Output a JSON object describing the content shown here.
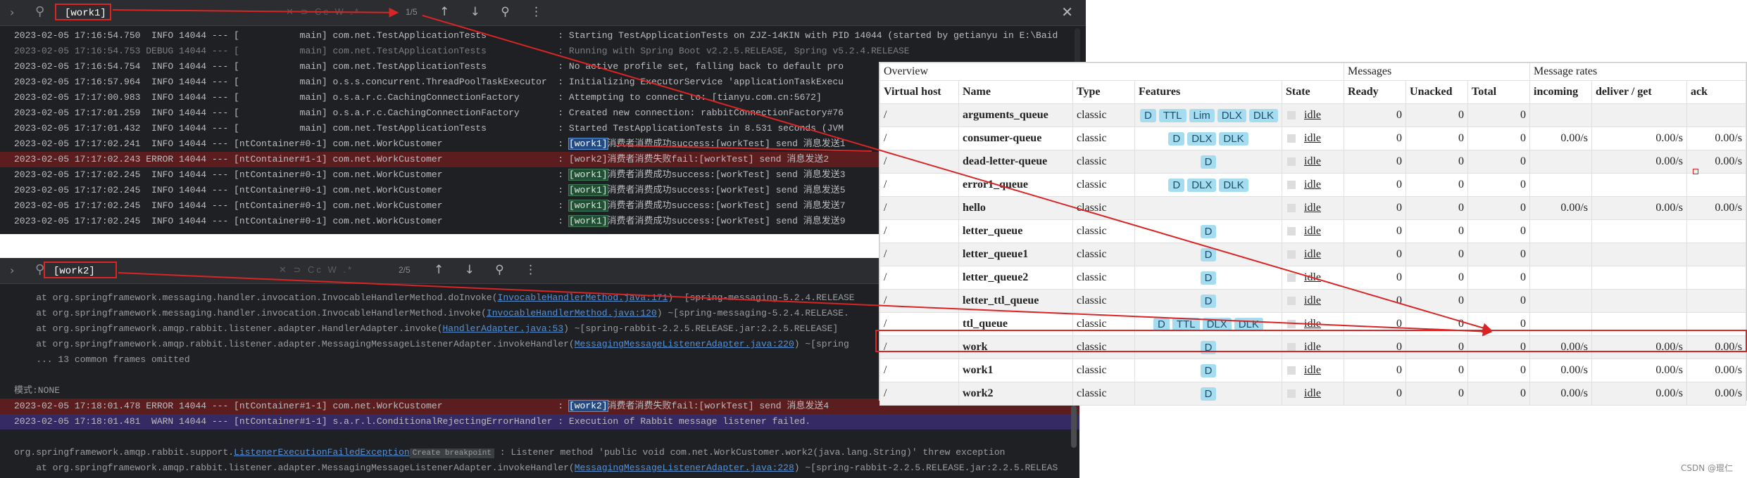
{
  "top_console": {
    "search_text": "[work1]",
    "search_options": "✕ ⊃ Cc W .*",
    "match_count": "1/5",
    "nav_icons": "↑ ↓ ⚲ ⋮",
    "close_glyph": "✕",
    "lines": [
      {
        "text": "2023-02-05 17:16:54.750  INFO 14044 --- [           main] com.net.TestApplicationTests             : Starting TestApplicationTests on ZJZ-14KIN with PID 14044 (started by getianyu in E:\\Baid",
        "kind": "info"
      },
      {
        "text": "2023-02-05 17:16:54.753 DEBUG 14044 --- [           main] com.net.TestApplicationTests             : Running with Spring Boot v2.2.5.RELEASE, Spring v5.2.4.RELEASE",
        "kind": "debug"
      },
      {
        "text": "2023-02-05 17:16:54.754  INFO 14044 --- [           main] com.net.TestApplicationTests             : No active profile set, falling back to default pro",
        "kind": "info"
      },
      {
        "text": "2023-02-05 17:16:57.964  INFO 14044 --- [           main] o.s.s.concurrent.ThreadPoolTaskExecutor  : Initializing ExecutorService 'applicationTaskExecu",
        "kind": "info"
      },
      {
        "text": "2023-02-05 17:17:00.983  INFO 14044 --- [           main] o.s.a.r.c.CachingConnectionFactory       : Attempting to connect to: [tianyu.com.cn:5672]",
        "kind": "info"
      },
      {
        "text": "2023-02-05 17:17:01.259  INFO 14044 --- [           main] o.s.a.r.c.CachingConnectionFactory       : Created new connection: rabbitConnectionFactory#76",
        "kind": "info"
      },
      {
        "text": "2023-02-05 17:17:01.432  INFO 14044 --- [           main] com.net.TestApplicationTests             : Started TestApplicationTests in 8.531 seconds (JVM",
        "kind": "info"
      },
      {
        "prefix": "2023-02-05 17:17:02.241  INFO 14044 --- [ntContainer#0-1] com.net.WorkCustomer                     : ",
        "tag": "[work1]",
        "tag_style": "blue",
        "suffix": "消费者消费成功success:[workTest] send 消息发送1",
        "kind": "info"
      },
      {
        "prefix": "2023-02-05 17:17:02.243 ERROR 14044 --- [ntContainer#1-1] com.net.WorkCustomer                     : ",
        "tag": "[work2]",
        "tag_style": "none",
        "suffix": "消费者消费失败fail:[workTest] send 消息发送2",
        "kind": "error"
      },
      {
        "prefix": "2023-02-05 17:17:02.245  INFO 14044 --- [ntContainer#0-1] com.net.WorkCustomer                     : ",
        "tag": "[work1]",
        "tag_style": "green",
        "suffix": "消费者消费成功success:[workTest] send 消息发送3",
        "kind": "info"
      },
      {
        "prefix": "2023-02-05 17:17:02.245  INFO 14044 --- [ntContainer#0-1] com.net.WorkCustomer                     : ",
        "tag": "[work1]",
        "tag_style": "green",
        "suffix": "消费者消费成功success:[workTest] send 消息发送5",
        "kind": "info"
      },
      {
        "prefix": "2023-02-05 17:17:02.245  INFO 14044 --- [ntContainer#0-1] com.net.WorkCustomer                     : ",
        "tag": "[work1]",
        "tag_style": "green",
        "suffix": "消费者消费成功success:[workTest] send 消息发送7",
        "kind": "info"
      },
      {
        "prefix": "2023-02-05 17:17:02.245  INFO 14044 --- [ntContainer#0-1] com.net.WorkCustomer                     : ",
        "tag": "[work1]",
        "tag_style": "green",
        "suffix": "消费者消费成功success:[workTest] send 消息发送9",
        "kind": "info"
      }
    ]
  },
  "bottom_console": {
    "search_text": "[work2]",
    "search_options": "✕ ⊃ Cc W .*",
    "match_count": "2/5",
    "nav_icons": "↑ ↓ ⚲ ⋮",
    "lines": [
      {
        "prefix": "    at org.springframework.messaging.handler.invocation.InvocableHandlerMethod.doInvoke(",
        "link": "InvocableHandlerMethod.java:171",
        "suffix": ") ~[spring-messaging-5.2.4.RELEASE",
        "kind": "dim"
      },
      {
        "prefix": "    at org.springframework.messaging.handler.invocation.InvocableHandlerMethod.invoke(",
        "link": "InvocableHandlerMethod.java:120",
        "suffix": ") ~[spring-messaging-5.2.4.RELEASE.",
        "kind": "dim"
      },
      {
        "prefix": "    at org.springframework.amqp.rabbit.listener.adapter.HandlerAdapter.invoke(",
        "link": "HandlerAdapter.java:53",
        "suffix": ") ~[spring-rabbit-2.2.5.RELEASE.jar:2.2.5.RELEASE]",
        "kind": "dim"
      },
      {
        "prefix": "    at org.springframework.amqp.rabbit.listener.adapter.MessagingMessageListenerAdapter.invokeHandler(",
        "link": "MessagingMessageListenerAdapter.java:220",
        "suffix": ") ~[spring",
        "kind": "dim"
      },
      {
        "text": "    ... 13 common frames omitted",
        "kind": "dim"
      },
      {
        "text": "",
        "kind": "dim"
      },
      {
        "text": "模式:NONE",
        "kind": "dim"
      },
      {
        "prefix": "2023-02-05 17:18:01.478 ERROR 14044 --- [ntContainer#1-1] com.net.WorkCustomer                     : ",
        "tag": "[work2]",
        "tag_style": "blue",
        "suffix": "消费者消费失败fail:[workTest] send 消息发送4",
        "kind": "error"
      },
      {
        "text": "2023-02-05 17:18:01.481  WARN 14044 --- [ntContainer#1-1] s.a.r.l.ConditionalRejectingErrorHandler : Execution of Rabbit message listener failed.",
        "kind": "warn-hl"
      },
      {
        "text": "",
        "kind": "dim"
      },
      {
        "prefix": "org.springframework.amqp.rabbit.support.",
        "link": "ListenerExecutionFailedException",
        "chip": "Create breakpoint",
        "suffix": " : Listener method 'public void com.net.WorkCustomer.work2(java.lang.String)' threw exception",
        "kind": "dim"
      },
      {
        "prefix": "    at org.springframework.amqp.rabbit.listener.adapter.MessagingMessageListenerAdapter.invokeHandler(",
        "link": "MessagingMessageListenerAdapter.java:228",
        "suffix": ") ~[spring-rabbit-2.2.5.RELEASE.jar:2.2.5.RELEAS",
        "kind": "dim"
      }
    ]
  },
  "queues": {
    "group_headers": [
      "Overview",
      "Messages",
      "Message rates"
    ],
    "columns": [
      "Virtual host",
      "Name",
      "Type",
      "Features",
      "State",
      "Ready",
      "Unacked",
      "Total",
      "incoming",
      "deliver / get",
      "ack"
    ],
    "rows": [
      {
        "vhost": "/",
        "name": "arguments_queue",
        "type": "classic",
        "features": [
          "D",
          "TTL",
          "Lim",
          "DLX",
          "DLK"
        ],
        "state": "idle",
        "ready": "0",
        "unacked": "0",
        "total": "0",
        "incoming": "",
        "deliver": "",
        "ack": ""
      },
      {
        "vhost": "/",
        "name": "consumer-queue",
        "type": "classic",
        "features": [
          "D",
          "DLX",
          "DLK"
        ],
        "state": "idle",
        "ready": "0",
        "unacked": "0",
        "total": "0",
        "incoming": "0.00/s",
        "deliver": "0.00/s",
        "ack": "0.00/s"
      },
      {
        "vhost": "/",
        "name": "dead-letter-queue",
        "type": "classic",
        "features": [
          "D"
        ],
        "state": "idle",
        "ready": "0",
        "unacked": "0",
        "total": "0",
        "incoming": "",
        "deliver": "0.00/s",
        "ack": "0.00/s"
      },
      {
        "vhost": "/",
        "name": "error1_queue",
        "type": "classic",
        "features": [
          "D",
          "DLX",
          "DLK"
        ],
        "state": "idle",
        "ready": "0",
        "unacked": "0",
        "total": "0",
        "incoming": "",
        "deliver": "",
        "ack": ""
      },
      {
        "vhost": "/",
        "name": "hello",
        "type": "classic",
        "features": [],
        "state": "idle",
        "ready": "0",
        "unacked": "0",
        "total": "0",
        "incoming": "0.00/s",
        "deliver": "0.00/s",
        "ack": "0.00/s"
      },
      {
        "vhost": "/",
        "name": "letter_queue",
        "type": "classic",
        "features": [
          "D"
        ],
        "state": "idle",
        "ready": "0",
        "unacked": "0",
        "total": "0",
        "incoming": "",
        "deliver": "",
        "ack": ""
      },
      {
        "vhost": "/",
        "name": "letter_queue1",
        "type": "classic",
        "features": [
          "D"
        ],
        "state": "idle",
        "ready": "0",
        "unacked": "0",
        "total": "0",
        "incoming": "",
        "deliver": "",
        "ack": ""
      },
      {
        "vhost": "/",
        "name": "letter_queue2",
        "type": "classic",
        "features": [
          "D"
        ],
        "state": "idle",
        "ready": "0",
        "unacked": "0",
        "total": "0",
        "incoming": "",
        "deliver": "",
        "ack": ""
      },
      {
        "vhost": "/",
        "name": "letter_ttl_queue",
        "type": "classic",
        "features": [
          "D"
        ],
        "state": "idle",
        "ready": "0",
        "unacked": "0",
        "total": "0",
        "incoming": "",
        "deliver": "",
        "ack": ""
      },
      {
        "vhost": "/",
        "name": "ttl_queue",
        "type": "classic",
        "features": [
          "D",
          "TTL",
          "DLX",
          "DLK"
        ],
        "state": "idle",
        "ready": "0",
        "unacked": "0",
        "total": "0",
        "incoming": "",
        "deliver": "",
        "ack": ""
      },
      {
        "vhost": "/",
        "name": "work",
        "type": "classic",
        "features": [
          "D"
        ],
        "state": "idle",
        "ready": "0",
        "unacked": "0",
        "total": "0",
        "incoming": "0.00/s",
        "deliver": "0.00/s",
        "ack": "0.00/s"
      },
      {
        "vhost": "/",
        "name": "work1",
        "type": "classic",
        "features": [
          "D"
        ],
        "state": "idle",
        "ready": "0",
        "unacked": "0",
        "total": "0",
        "incoming": "0.00/s",
        "deliver": "0.00/s",
        "ack": "0.00/s"
      },
      {
        "vhost": "/",
        "name": "work2",
        "type": "classic",
        "features": [
          "D"
        ],
        "state": "idle",
        "ready": "0",
        "unacked": "0",
        "total": "0",
        "incoming": "0.00/s",
        "deliver": "0.00/s",
        "ack": "0.00/s"
      }
    ]
  },
  "watermark": "CSDN @琨仁",
  "colors": {
    "annotation_red": "#d82525",
    "feature_badge": "#a6dcef",
    "console_bg": "#1f2023",
    "error_row": "#5c1d1f"
  }
}
